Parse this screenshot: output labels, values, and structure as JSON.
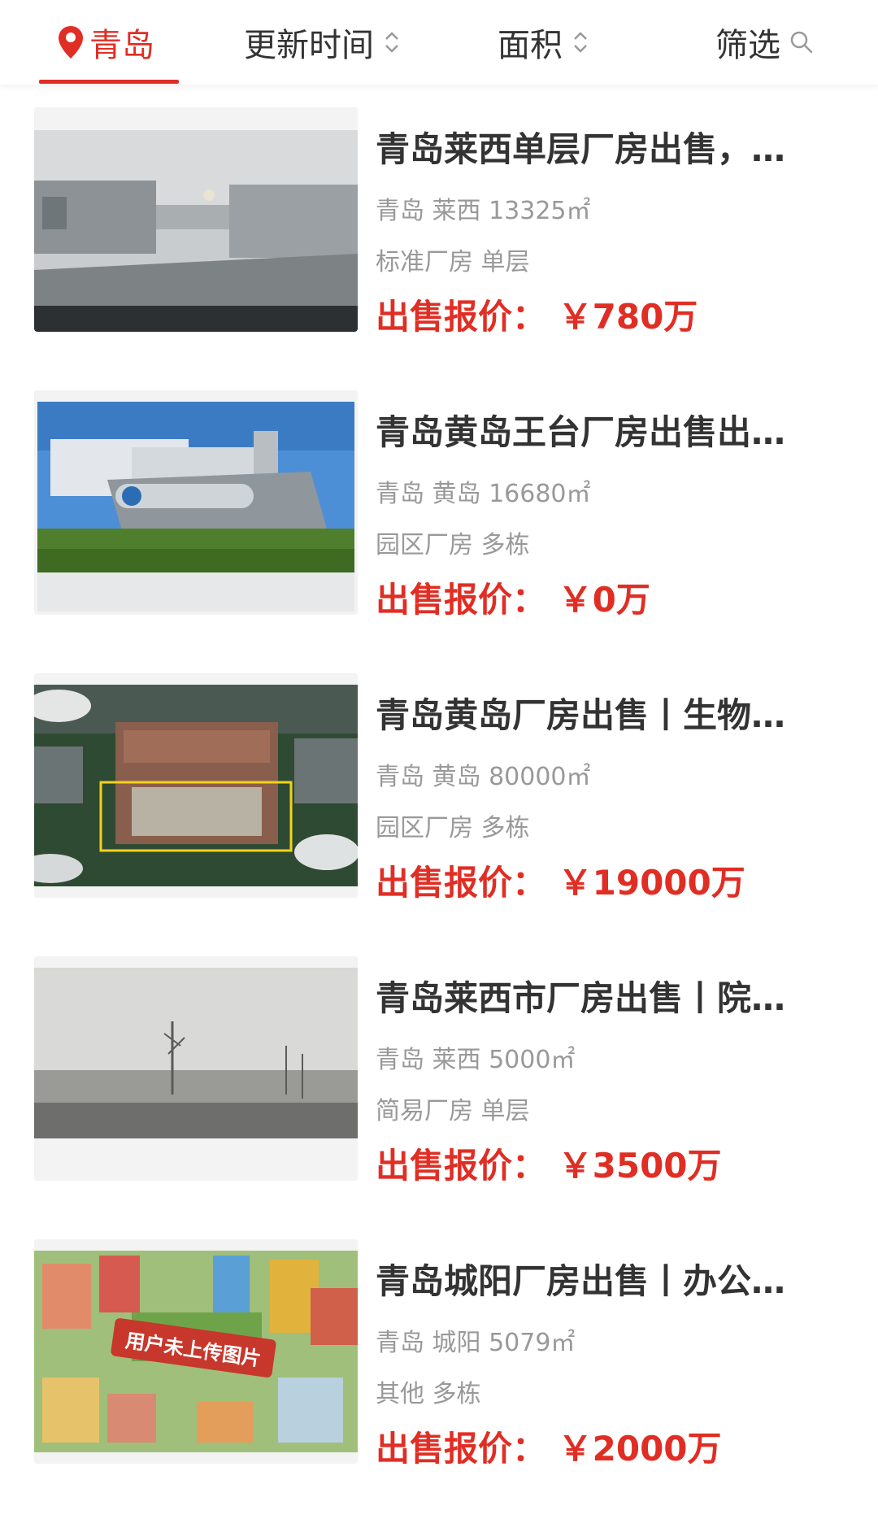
{
  "header": {
    "city": "青岛",
    "sort_update": "更新时间",
    "sort_area": "面积",
    "filter": "筛选",
    "accent_color": "#e02e24"
  },
  "listings": [
    {
      "title": "青岛莱西单层厂房出售，…",
      "location": "青岛 莱西 13325㎡",
      "type": "标准厂房 单层",
      "price_label": "出售报价：",
      "price": "￥780万"
    },
    {
      "title": "青岛黄岛王台厂房出售出…",
      "location": "青岛 黄岛 16680㎡",
      "type": "园区厂房 多栋",
      "price_label": "出售报价：",
      "price": "￥0万"
    },
    {
      "title": "青岛黄岛厂房出售丨生物…",
      "location": "青岛 黄岛 80000㎡",
      "type": "园区厂房 多栋",
      "price_label": "出售报价：",
      "price": "￥19000万"
    },
    {
      "title": "青岛莱西市厂房出售丨院…",
      "location": "青岛 莱西 5000㎡",
      "type": "简易厂房 单层",
      "price_label": "出售报价：",
      "price": "￥3500万"
    },
    {
      "title": "青岛城阳厂房出售丨办公…",
      "location": "青岛 城阳 5079㎡",
      "type": "其他 多栋",
      "price_label": "出售报价：",
      "price": "￥2000万",
      "image_caption": "用户未上传图片"
    }
  ]
}
